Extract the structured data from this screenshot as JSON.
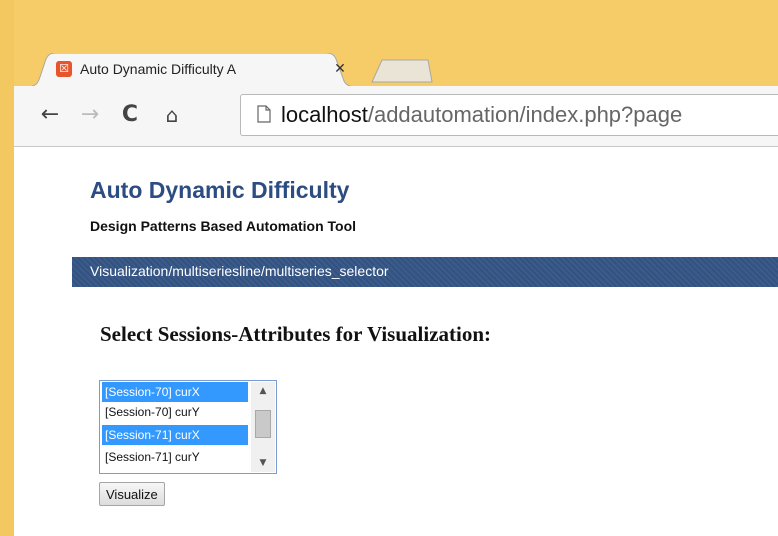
{
  "browser": {
    "tab": {
      "favicon_glyph": "☒",
      "title": "Auto Dynamic Difficulty A",
      "close_glyph": "✕"
    },
    "toolbar": {
      "back_glyph": "←",
      "forward_glyph": "→",
      "reload_glyph": "C",
      "home_glyph": "⌂"
    },
    "address": {
      "host": "localhost",
      "path": "/addautomation/index.php?page"
    }
  },
  "page": {
    "site_title": "Auto Dynamic Difficulty",
    "site_subtitle": "Design Patterns Based Automation Tool",
    "breadcrumb": "Visualization/multiseriesline/multiseries_selector",
    "heading": "Select Sessions-Attributes for Visualization:",
    "listbox": {
      "options": [
        {
          "label": "[Session-70] curX",
          "selected": true
        },
        {
          "label": "[Session-70] curY",
          "selected": false
        },
        {
          "label": "[Session-71] curX",
          "selected": true
        },
        {
          "label": "[Session-71] curY",
          "selected": false
        }
      ],
      "scroll_up_glyph": "▲",
      "scroll_down_glyph": "▼"
    },
    "visualize_button": "Visualize"
  },
  "colors": {
    "window_frame": "#f5cc68",
    "title_blue": "#2d4c82",
    "breadcrumb_bar": "#34527f",
    "selection": "#3399ff"
  }
}
